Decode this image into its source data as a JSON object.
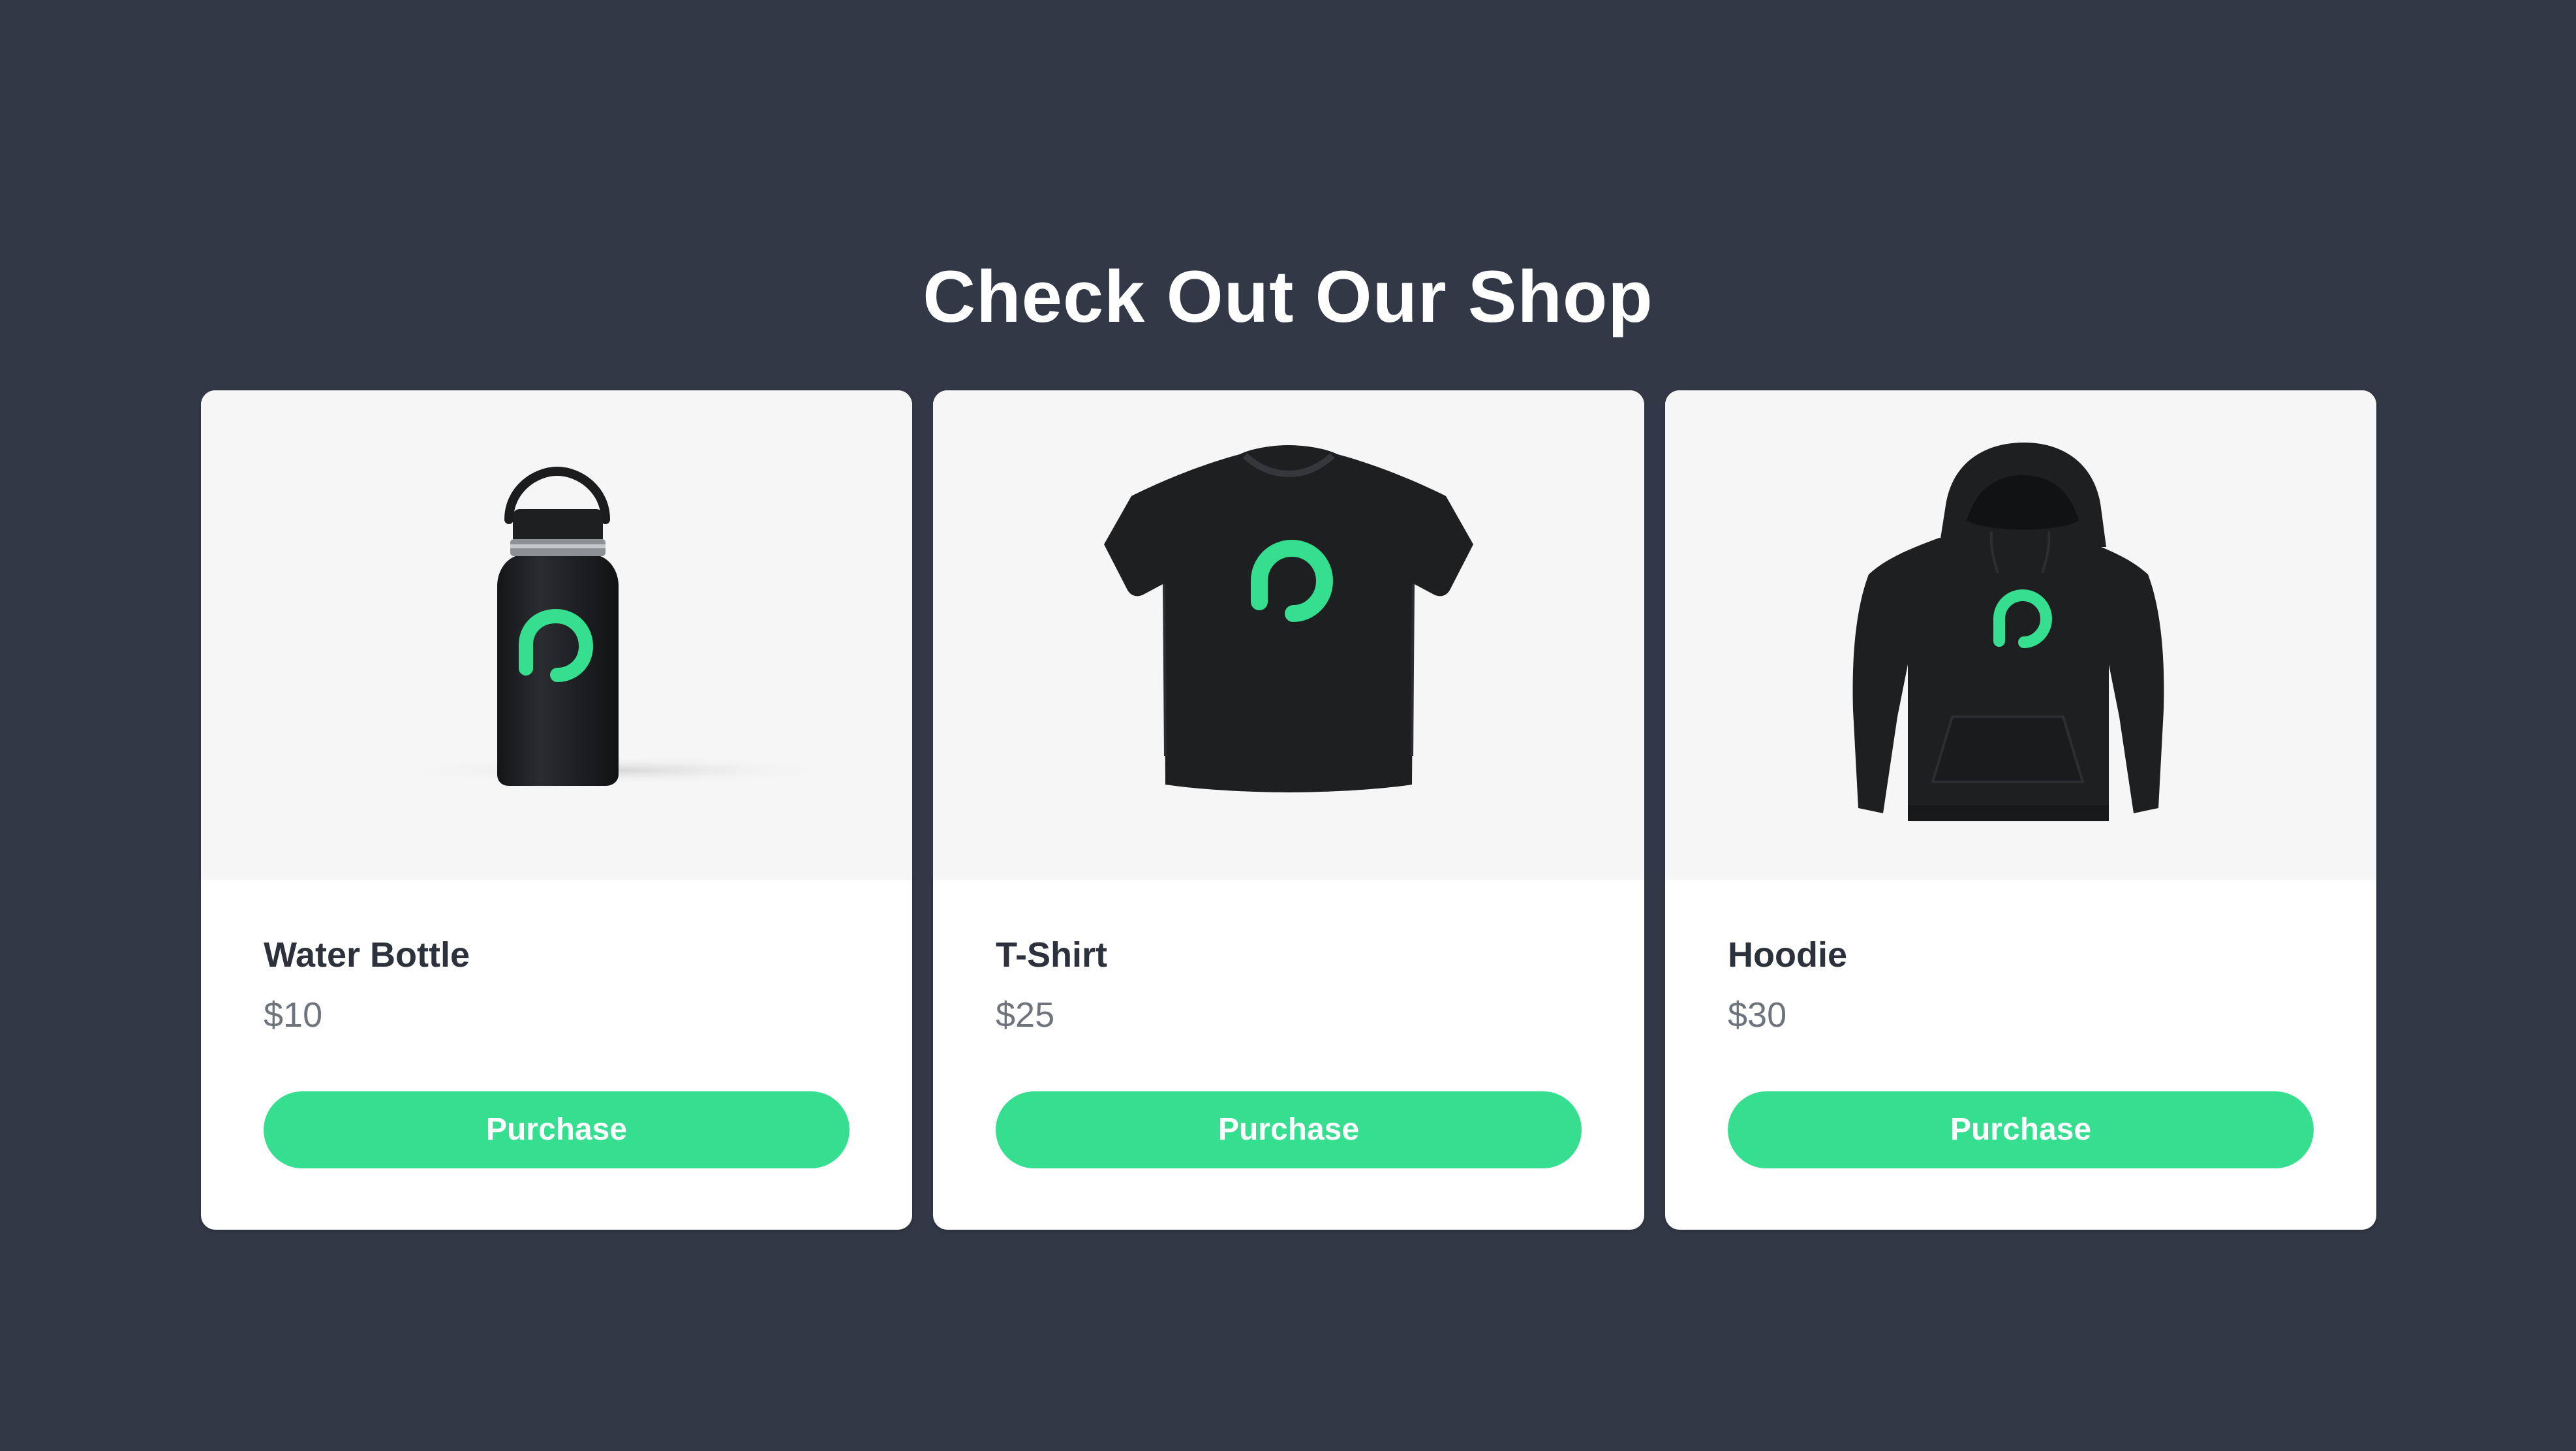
{
  "page": {
    "title": "Check Out Our Shop"
  },
  "colors": {
    "background": "#333846",
    "card": "#ffffff",
    "image_area": "#f6f6f6",
    "accent": "#36df8f",
    "product_dark": "#1e1f21",
    "heading_text": "#2c313b",
    "price_text": "#6f747c"
  },
  "products": [
    {
      "name": "Water Bottle",
      "price": "$10",
      "button_label": "Purchase",
      "image_icon": "water-bottle-image"
    },
    {
      "name": "T-Shirt",
      "price": "$25",
      "button_label": "Purchase",
      "image_icon": "t-shirt-image"
    },
    {
      "name": "Hoodie",
      "price": "$30",
      "button_label": "Purchase",
      "image_icon": "hoodie-image"
    }
  ]
}
